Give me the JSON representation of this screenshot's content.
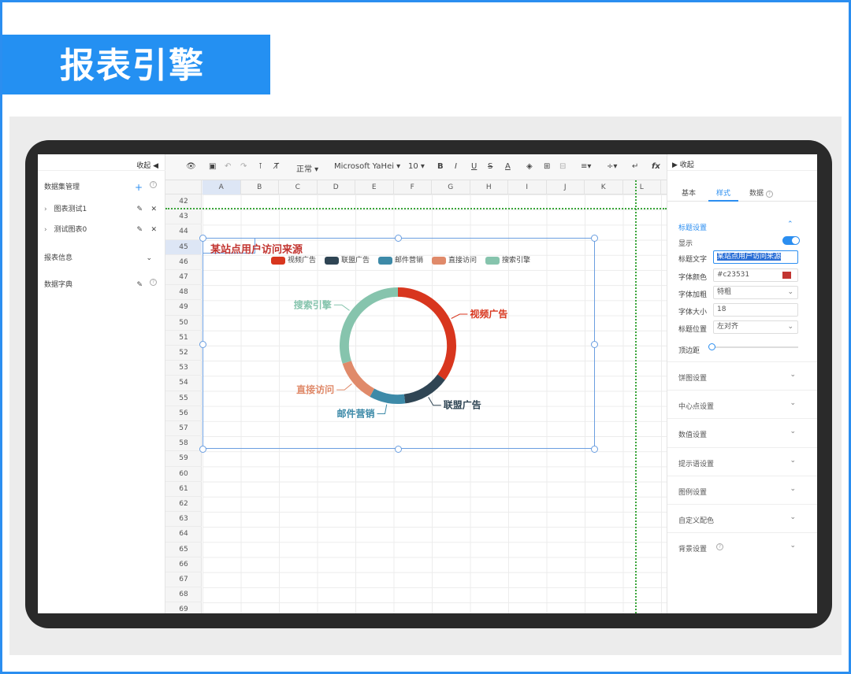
{
  "banner": {
    "title": "报表引擎"
  },
  "left_panel": {
    "collapse_label": "收起",
    "dataset_header": "数据集管理",
    "datasets": [
      {
        "label": "图表测试1"
      },
      {
        "label": "测试图表0"
      }
    ],
    "report_info": "报表信息",
    "data_dict": "数据字典"
  },
  "toolbar": {
    "style_select": "正常",
    "font_select": "Microsoft YaHei",
    "size_select": "10",
    "fx_label": "fx"
  },
  "sheet": {
    "columns": [
      "A",
      "B",
      "C",
      "D",
      "E",
      "F",
      "G",
      "H",
      "I",
      "J",
      "K",
      "L"
    ],
    "rows": [
      "42",
      "43",
      "44",
      "45",
      "46",
      "47",
      "48",
      "49",
      "50",
      "51",
      "52",
      "53",
      "54",
      "55",
      "56",
      "57",
      "58",
      "59",
      "60",
      "61",
      "62",
      "63",
      "64",
      "65",
      "66",
      "67",
      "68",
      "69"
    ],
    "selected_col": "A",
    "selected_row": "45"
  },
  "chart_data": {
    "type": "pie",
    "title": "某站点用户访问来源",
    "title_color": "#c23531",
    "legend_position": "top",
    "categories": [
      "视频广告",
      "联盟广告",
      "邮件营销",
      "直接访问",
      "搜索引擎"
    ],
    "values": [
      35,
      13,
      10,
      12,
      30
    ],
    "colors": [
      "#d8361e",
      "#2f4554",
      "#3d8aa8",
      "#e08a6a",
      "#86c4ad"
    ],
    "inner_radius_ratio": 0.84
  },
  "right_panel": {
    "collapse_label": "收起",
    "tabs": [
      {
        "label": "基本",
        "active": false
      },
      {
        "label": "样式",
        "active": true
      },
      {
        "label": "数据",
        "active": false
      }
    ],
    "title_section": "标题设置",
    "show_label": "显示",
    "show_on": true,
    "title_text_label": "标题文字",
    "title_text_value": "某站点用户访问来源",
    "font_color_label": "字体颜色",
    "font_color_value": "#c23531",
    "font_weight_label": "字体加粗",
    "font_weight_value": "特粗",
    "font_size_label": "字体大小",
    "font_size_value": "18",
    "title_pos_label": "标题位置",
    "title_pos_value": "左对齐",
    "top_margin_label": "顶边距",
    "top_margin_value": 0,
    "sections": [
      "饼图设置",
      "中心点设置",
      "数值设置",
      "提示语设置",
      "图例设置",
      "自定义配色",
      "背景设置"
    ]
  }
}
